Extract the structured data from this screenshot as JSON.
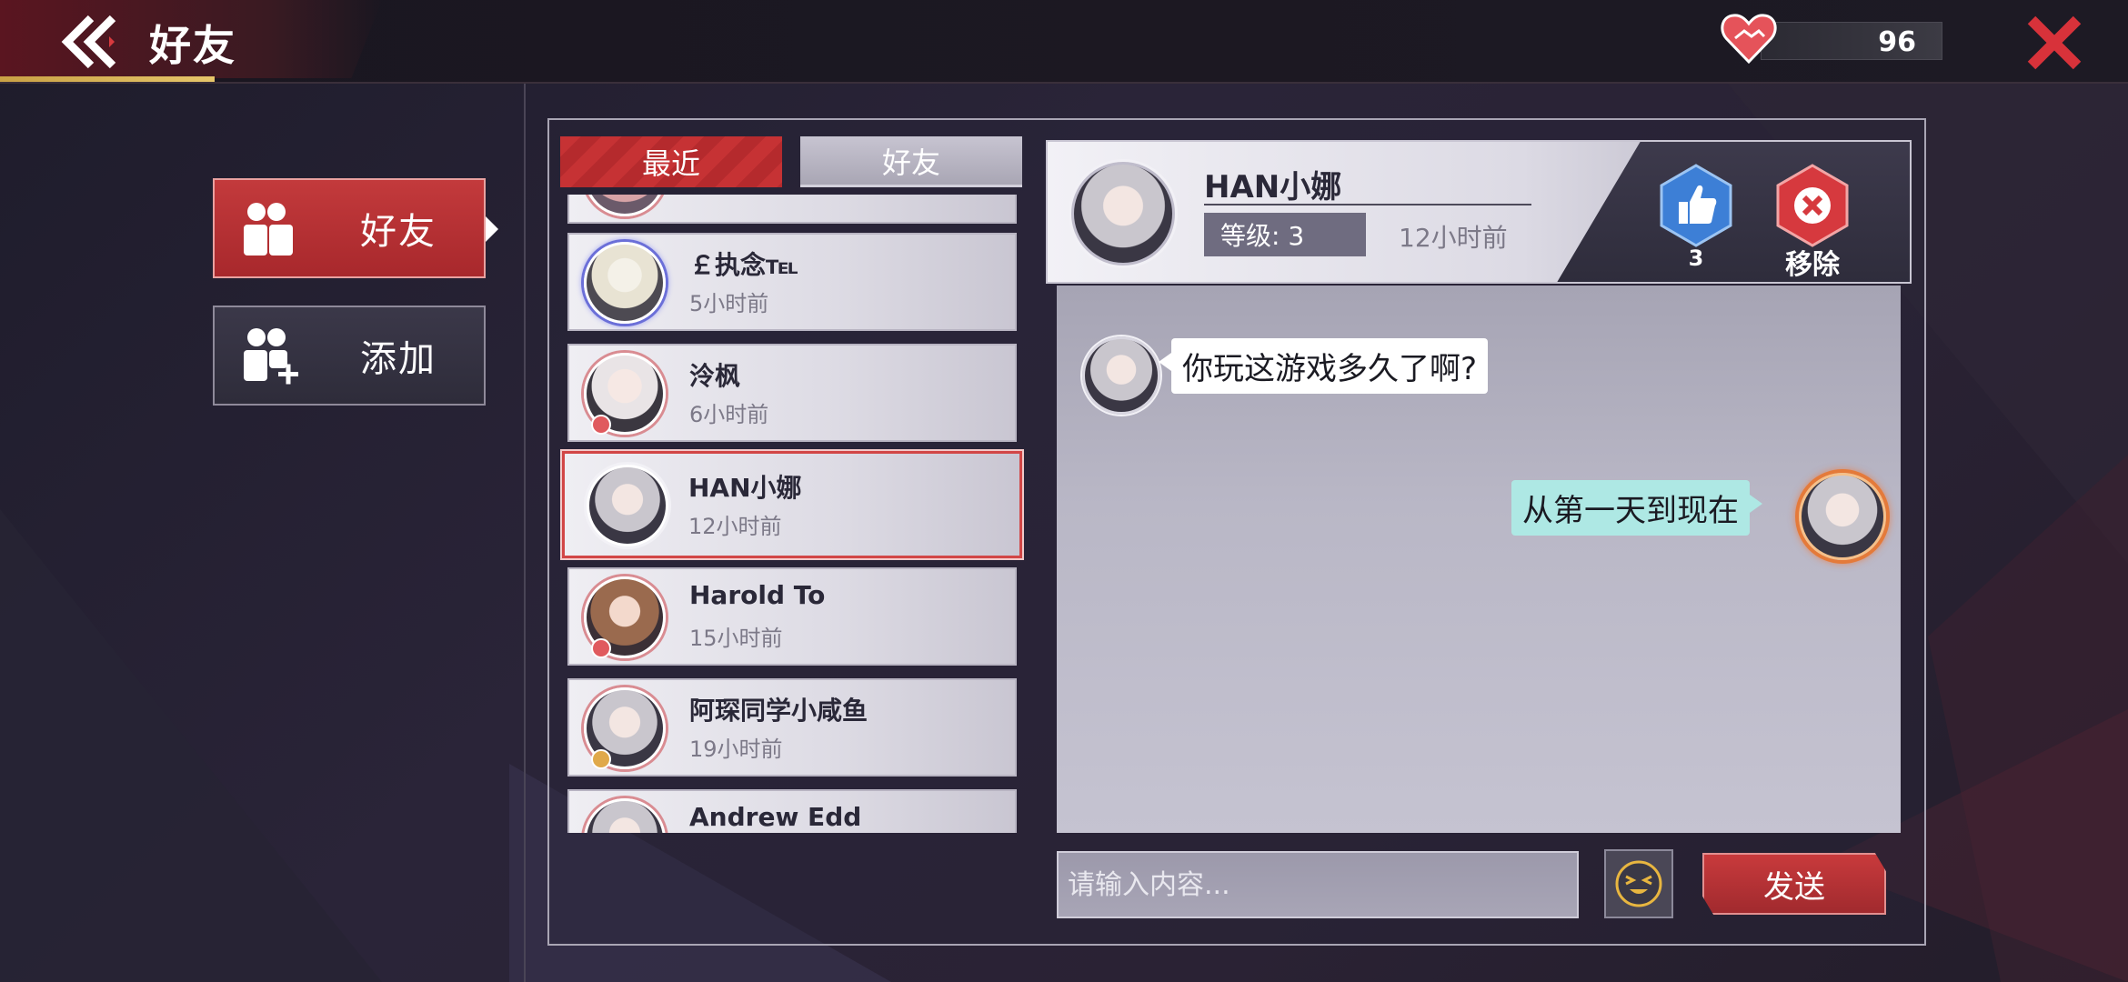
{
  "header": {
    "title": "好友",
    "hearts": "96"
  },
  "nav": {
    "items": [
      {
        "label": "好友",
        "active": true
      },
      {
        "label": "添加",
        "active": false
      }
    ]
  },
  "tabs": [
    {
      "label": "最近",
      "active": true
    },
    {
      "label": "好友",
      "active": false
    }
  ],
  "friends": [
    {
      "name": "",
      "time": ""
    },
    {
      "name": "￡执念℡",
      "time": "5小时前"
    },
    {
      "name": "泠枫",
      "time": "6小时前"
    },
    {
      "name": "HAN小娜",
      "time": "12小时前",
      "selected": true
    },
    {
      "name": "Harold To",
      "time": "15小时前"
    },
    {
      "name": "阿琛同学小咸鱼",
      "time": "19小时前"
    },
    {
      "name": "Andrew Edd",
      "time": ""
    }
  ],
  "chat": {
    "name": "HAN小娜",
    "level": "等级: 3",
    "last_seen": "12小时前",
    "likes": "3",
    "remove_label": "移除",
    "messages": [
      {
        "side": "left",
        "text": "你玩这游戏多久了啊?"
      },
      {
        "side": "right",
        "text": "从第一天到现在"
      }
    ],
    "input_placeholder": "请输入内容...",
    "send_label": "发送"
  },
  "colors": {
    "accent_red": "#c63234",
    "panel_light": "#efeef3",
    "bubble_right": "#aee8e4",
    "gold": "#c9a145"
  },
  "icons": [
    "back-chevrons-icon",
    "heart-handshake-icon",
    "close-icon",
    "friends-icon",
    "add-friend-icon",
    "thumbs-up-icon",
    "remove-x-icon",
    "emoji-icon"
  ]
}
